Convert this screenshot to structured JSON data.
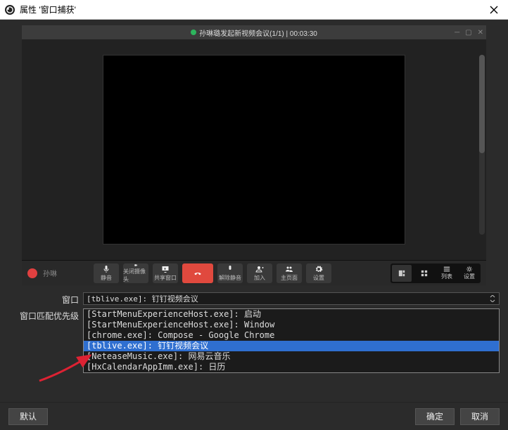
{
  "dialog": {
    "title": "属性 '窗口捕获'"
  },
  "preview": {
    "header_text": "孙琳璐发起新视频会议(1/1) | 00:03:30",
    "caller_name": "孙琳",
    "tools": {
      "mute": "静音",
      "camera": "关闭摄像头",
      "share": "共享窗口",
      "hangup": "",
      "record": "解除静音",
      "invite": "加入",
      "members": "主页面",
      "settings": "设置"
    },
    "right": {
      "grid": "",
      "tile": "",
      "list": "列表",
      "set": "设置"
    }
  },
  "form": {
    "window_label": "窗口",
    "window_value": "[tblive.exe]: 钉钉视频会议",
    "priority_label": "窗口匹配优先级",
    "options": [
      "[StartMenuExperienceHost.exe]: 启动",
      "[StartMenuExperienceHost.exe]: Window",
      "[chrome.exe]: Compose - Google Chrome",
      "[tblive.exe]: 钉钉视频会议",
      "[NeteaseMusic.exe]: 网易云音乐",
      "[HxCalendarAppImm.exe]: 日历"
    ],
    "selected_index": 3
  },
  "buttons": {
    "defaults": "默认",
    "ok": "确定",
    "cancel": "取消"
  }
}
